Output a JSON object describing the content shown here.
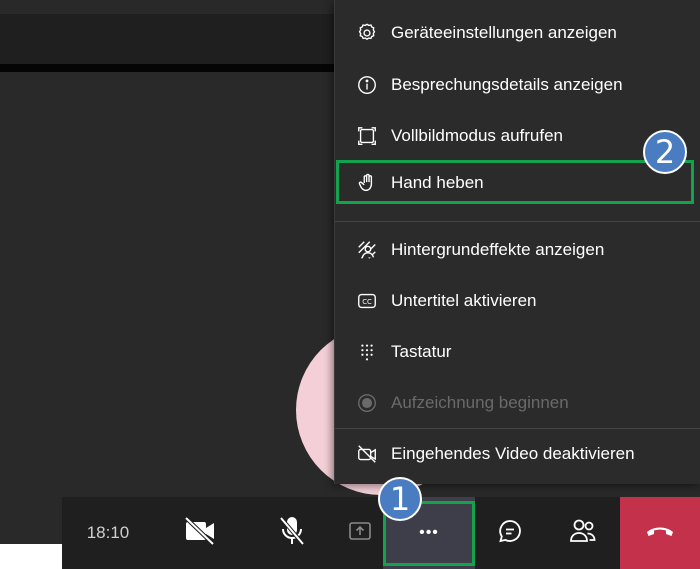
{
  "menu": {
    "items": [
      {
        "label": "Geräteeinstellungen anzeigen",
        "icon": "gear-icon",
        "enabled": true
      },
      {
        "label": "Besprechungsdetails anzeigen",
        "icon": "info-icon",
        "enabled": true
      },
      {
        "label": "Vollbildmodus aufrufen",
        "icon": "fullscreen-icon",
        "enabled": true
      },
      {
        "label": "Hand heben",
        "icon": "hand-icon",
        "enabled": true
      },
      {
        "label": "Hintergrundeffekte anzeigen",
        "icon": "background-effects-icon",
        "enabled": true
      },
      {
        "label": "Untertitel aktivieren",
        "icon": "captions-icon",
        "enabled": true
      },
      {
        "label": "Tastatur",
        "icon": "keypad-icon",
        "enabled": true
      },
      {
        "label": "Aufzeichnung beginnen",
        "icon": "record-icon",
        "enabled": false
      },
      {
        "label": "Eingehendes Video deaktivieren",
        "icon": "video-off-icon",
        "enabled": true
      }
    ]
  },
  "badges": {
    "one": "1",
    "two": "2"
  },
  "controlbar": {
    "timer": "18:10",
    "more": "•••"
  },
  "colors": {
    "stage": "#292929",
    "menu": "#2b2b2b",
    "highlight": "#13a34c",
    "badge": "#4a7cc2",
    "hangup": "#c4314b",
    "avatar": "#f4cfd8"
  }
}
